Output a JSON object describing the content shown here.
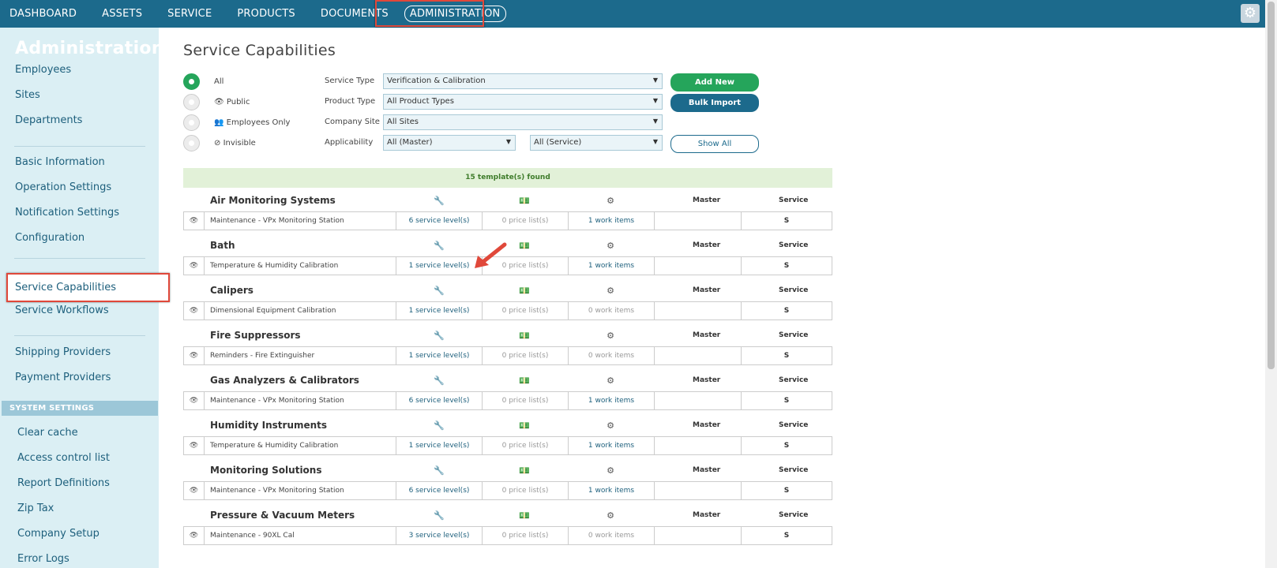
{
  "nav": {
    "items": [
      "DASHBOARD",
      "ASSETS",
      "SERVICE",
      "PRODUCTS",
      "DOCUMENTS"
    ],
    "active": "ADMINISTRATION"
  },
  "sidebar": {
    "title": "Administration",
    "items": [
      "Employees",
      "Sites",
      "Departments",
      "Basic Information",
      "Operation Settings",
      "Notification Settings",
      "Configuration",
      "Service Capabilities",
      "Service Workflows",
      "Shipping Providers",
      "Payment Providers"
    ],
    "section_header": "SYSTEM SETTINGS",
    "system_items": [
      "Clear cache",
      "Access control list",
      "Report Definitions",
      "Zip Tax",
      "Company Setup",
      "Error Logs"
    ]
  },
  "page": {
    "title": "Service Capabilities"
  },
  "filters": {
    "visibility": [
      "All",
      "Public",
      "Employees Only",
      "Invisible"
    ],
    "service_type_label": "Service Type",
    "service_type_value": "Verification & Calibration",
    "product_type_label": "Product Type",
    "product_type_value": "All Product Types",
    "company_site_label": "Company Site",
    "company_site_value": "All Sites",
    "applicability_label": "Applicability",
    "applicability_master": "All (Master)",
    "applicability_service": "All (Service)"
  },
  "buttons": {
    "add_new": "Add New",
    "bulk_import": "Bulk Import",
    "show_all": "Show All"
  },
  "results": {
    "found_text": "15 template(s) found",
    "master_header": "Master",
    "service_header": "Service",
    "groups": [
      {
        "name": "Air Monitoring Systems",
        "template": "Maintenance - VPx Monitoring Station",
        "service_levels": "6 service level(s)",
        "price_lists": "0 price list(s)",
        "work_items": "1 work items",
        "service": "S"
      },
      {
        "name": "Bath",
        "template": "Temperature & Humidity Calibration",
        "service_levels": "1 service level(s)",
        "price_lists": "0 price list(s)",
        "work_items": "1 work items",
        "service": "S"
      },
      {
        "name": "Calipers",
        "template": "Dimensional Equipment Calibration",
        "service_levels": "1 service level(s)",
        "price_lists": "0 price list(s)",
        "work_items": "0 work items",
        "service": "S"
      },
      {
        "name": "Fire Suppressors",
        "template": "Reminders - Fire Extinguisher",
        "service_levels": "1 service level(s)",
        "price_lists": "0 price list(s)",
        "work_items": "0 work items",
        "service": "S"
      },
      {
        "name": "Gas Analyzers & Calibrators",
        "template": "Maintenance - VPx Monitoring Station",
        "service_levels": "6 service level(s)",
        "price_lists": "0 price list(s)",
        "work_items": "1 work items",
        "service": "S"
      },
      {
        "name": "Humidity Instruments",
        "template": "Temperature & Humidity Calibration",
        "service_levels": "1 service level(s)",
        "price_lists": "0 price list(s)",
        "work_items": "1 work items",
        "service": "S"
      },
      {
        "name": "Monitoring Solutions",
        "template": "Maintenance - VPx Monitoring Station",
        "service_levels": "6 service level(s)",
        "price_lists": "0 price list(s)",
        "work_items": "1 work items",
        "service": "S"
      },
      {
        "name": "Pressure & Vacuum Meters",
        "template": "Maintenance - 90XL Cal",
        "service_levels": "3 service level(s)",
        "price_lists": "0 price list(s)",
        "work_items": "0 work items",
        "service": "S"
      }
    ]
  },
  "icons": {
    "wrench": "wrench-icon",
    "price": "money-icon",
    "work": "gear-icon",
    "eye": "eye-icon"
  },
  "colors": {
    "topbar": "#1c6a8c",
    "sidebar": "#dbeff4",
    "green": "#25a55b",
    "highlight": "#e0483a"
  }
}
